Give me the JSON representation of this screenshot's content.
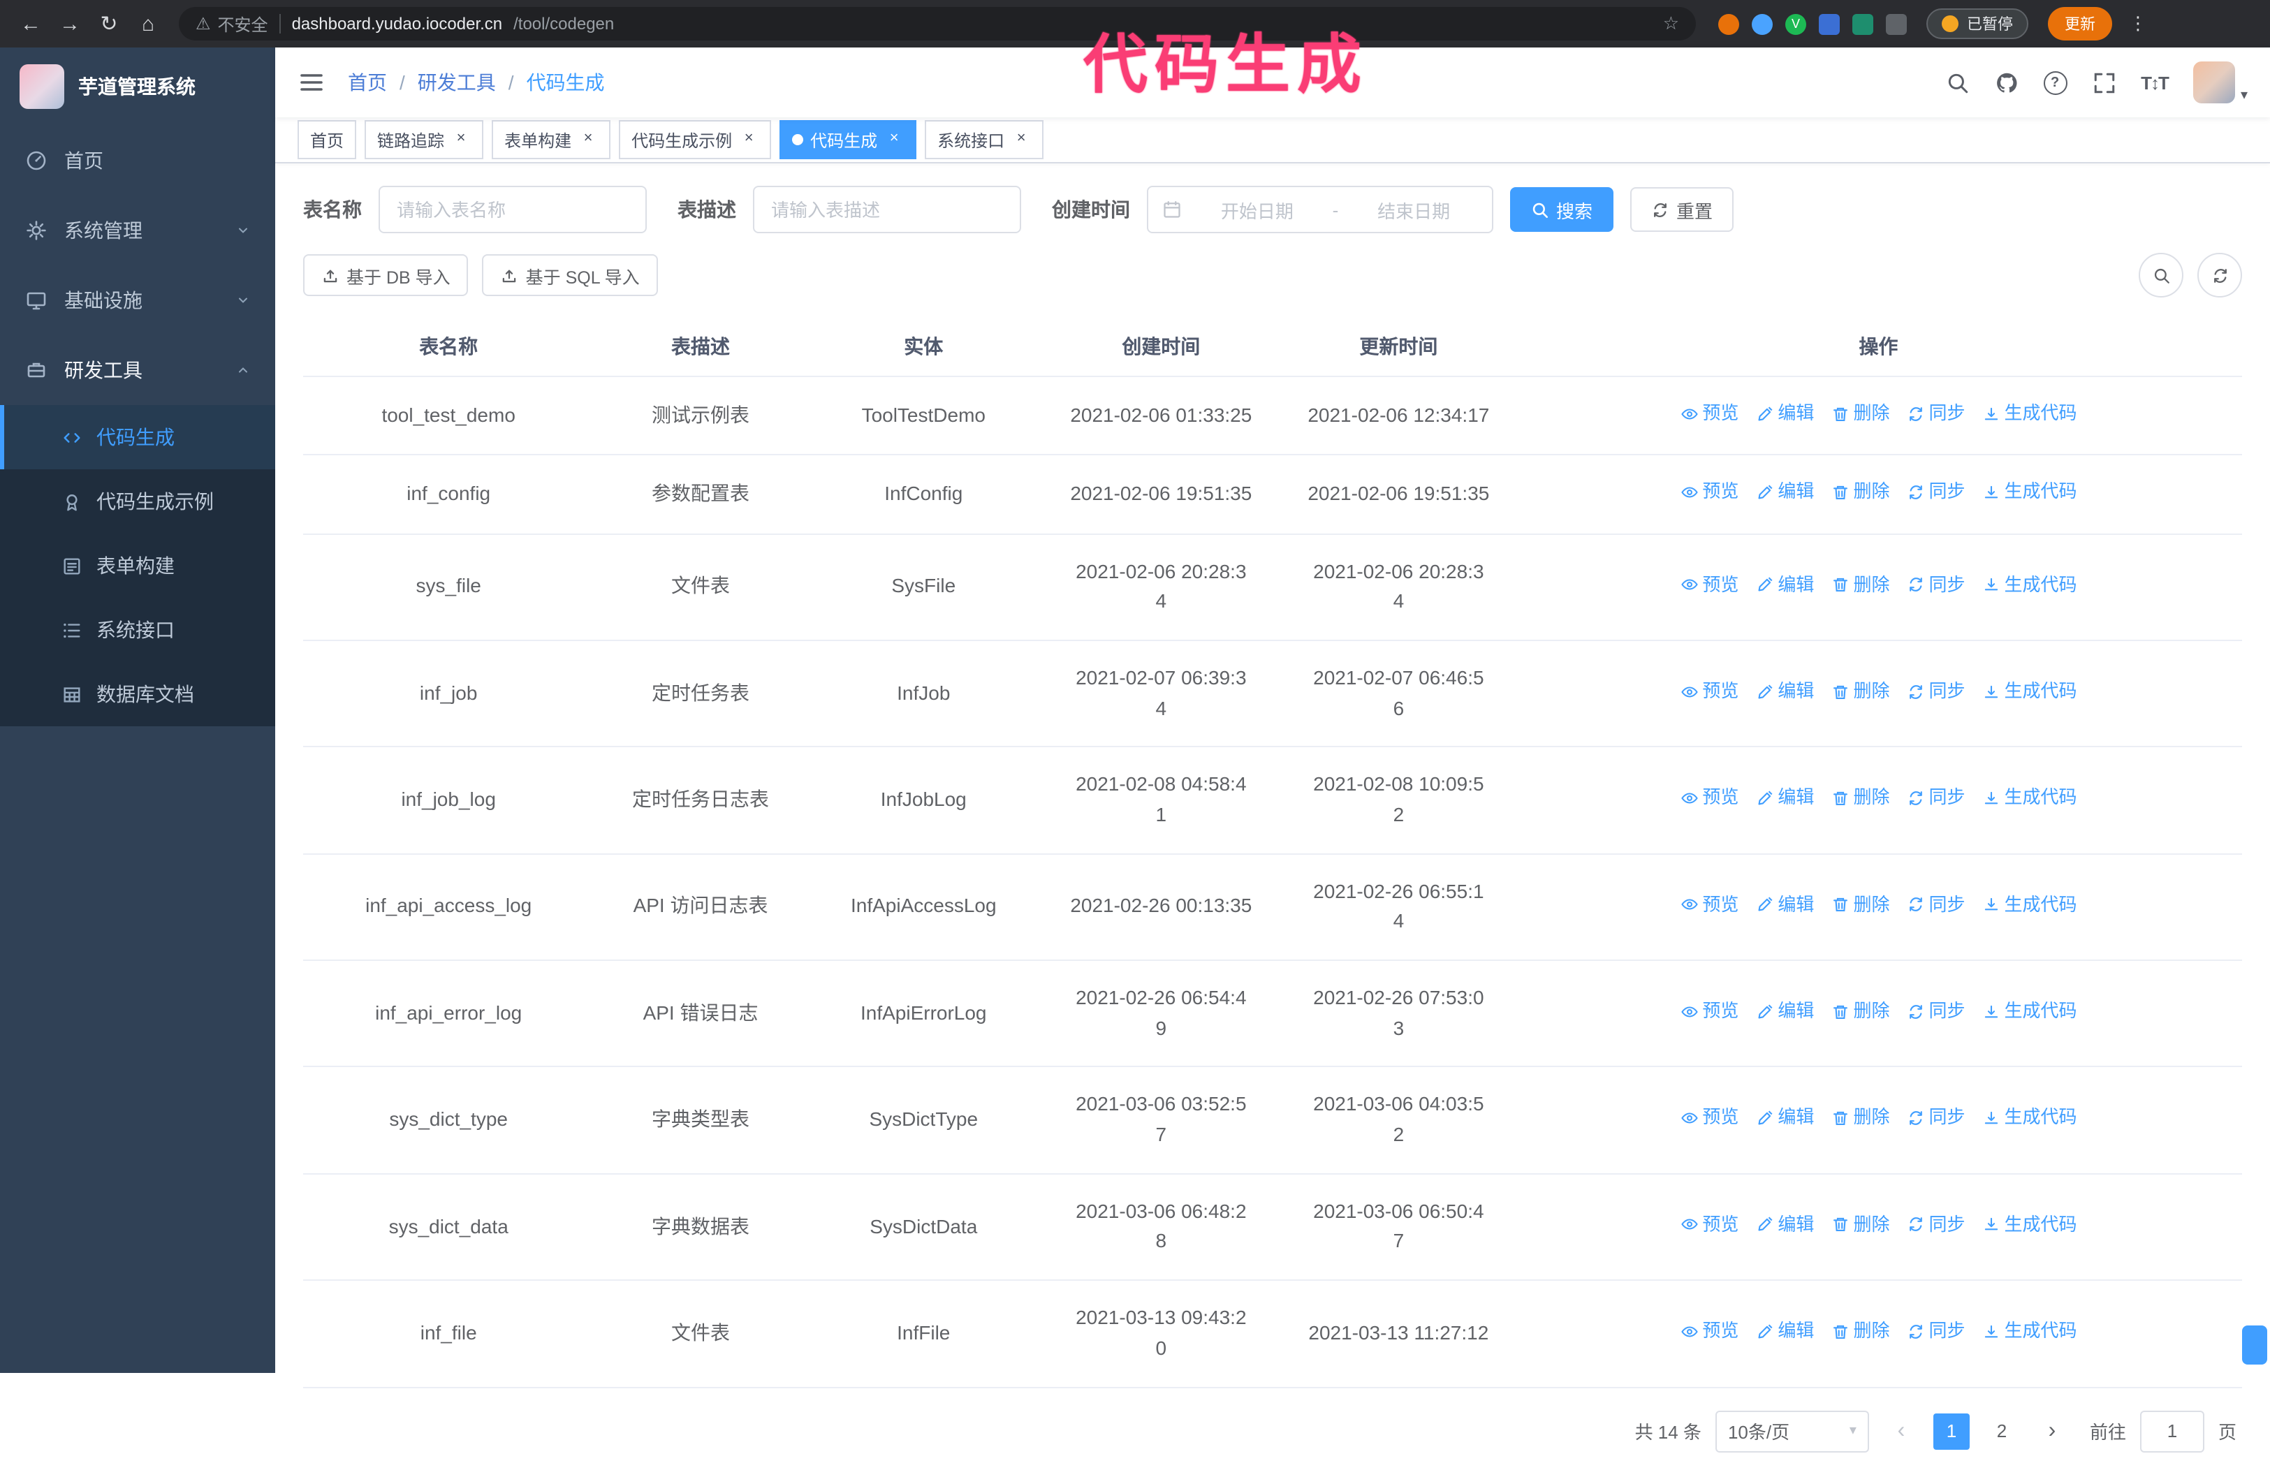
{
  "colors": {
    "accent": "#409eff",
    "annotation": "#fa3d75",
    "sidebar_bg": "#304156"
  },
  "annotation": {
    "text": "代码生成"
  },
  "browser": {
    "security_warning": "不安全",
    "url_host": "dashboard.yudao.iocoder.cn",
    "url_path": "/tool/codegen",
    "paused_badge": "已暂停",
    "update_button": "更新"
  },
  "sidebar": {
    "logo_title": "芋道管理系统",
    "items": [
      {
        "label": "首页",
        "icon": "dashboard-icon"
      },
      {
        "label": "系统管理",
        "icon": "gear-icon"
      },
      {
        "label": "基础设施",
        "icon": "monitor-icon"
      },
      {
        "label": "研发工具",
        "icon": "toolbox-icon"
      }
    ],
    "subitems": [
      {
        "label": "代码生成",
        "icon": "code-icon",
        "active": true
      },
      {
        "label": "代码生成示例",
        "icon": "badge-icon",
        "active": false
      },
      {
        "label": "表单构建",
        "icon": "form-icon",
        "active": false
      },
      {
        "label": "系统接口",
        "icon": "api-list-icon",
        "active": false
      },
      {
        "label": "数据库文档",
        "icon": "db-table-icon",
        "active": false
      }
    ]
  },
  "header": {
    "breadcrumb": [
      "首页",
      "研发工具",
      "代码生成"
    ]
  },
  "tabs": [
    {
      "label": "首页",
      "closable": false,
      "active": false
    },
    {
      "label": "链路追踪",
      "closable": true,
      "active": false
    },
    {
      "label": "表单构建",
      "closable": true,
      "active": false
    },
    {
      "label": "代码生成示例",
      "closable": true,
      "active": false
    },
    {
      "label": "代码生成",
      "closable": true,
      "active": true
    },
    {
      "label": "系统接口",
      "closable": true,
      "active": false
    }
  ],
  "filters": {
    "table_name_label": "表名称",
    "table_name_placeholder": "请输入表名称",
    "table_desc_label": "表描述",
    "table_desc_placeholder": "请输入表描述",
    "create_time_label": "创建时间",
    "date_start_placeholder": "开始日期",
    "date_separator": "-",
    "date_end_placeholder": "结束日期",
    "search_button": "搜索",
    "reset_button": "重置"
  },
  "toolbar": {
    "import_db_button": "基于 DB 导入",
    "import_sql_button": "基于 SQL 导入"
  },
  "table": {
    "columns": [
      "表名称",
      "表描述",
      "实体",
      "创建时间",
      "更新时间",
      "操作"
    ],
    "actions": [
      {
        "key": "preview",
        "label": "预览",
        "icon": "eye-icon"
      },
      {
        "key": "edit",
        "label": "编辑",
        "icon": "pen-icon"
      },
      {
        "key": "delete",
        "label": "删除",
        "icon": "trash-icon"
      },
      {
        "key": "sync",
        "label": "同步",
        "icon": "sync-icon"
      },
      {
        "key": "generate",
        "label": "生成代码",
        "icon": "download-icon"
      }
    ],
    "rows": [
      {
        "name": "tool_test_demo",
        "desc": "测试示例表",
        "entity": "ToolTestDemo",
        "created": "2021-02-06 01:33:25",
        "updated": "2021-02-06 12:34:17"
      },
      {
        "name": "inf_config",
        "desc": "参数配置表",
        "entity": "InfConfig",
        "created": "2021-02-06 19:51:35",
        "updated": "2021-02-06 19:51:35"
      },
      {
        "name": "sys_file",
        "desc": "文件表",
        "entity": "SysFile",
        "created": "2021-02-06 20:28:3\n4",
        "updated": "2021-02-06 20:28:3\n4"
      },
      {
        "name": "inf_job",
        "desc": "定时任务表",
        "entity": "InfJob",
        "created": "2021-02-07 06:39:3\n4",
        "updated": "2021-02-07 06:46:5\n6"
      },
      {
        "name": "inf_job_log",
        "desc": "定时任务日志表",
        "entity": "InfJobLog",
        "created": "2021-02-08 04:58:4\n1",
        "updated": "2021-02-08 10:09:5\n2"
      },
      {
        "name": "inf_api_access_log",
        "desc": "API 访问日志表",
        "entity": "InfApiAccessLog",
        "created": "2021-02-26 00:13:35",
        "updated": "2021-02-26 06:55:1\n4"
      },
      {
        "name": "inf_api_error_log",
        "desc": "API 错误日志",
        "entity": "InfApiErrorLog",
        "created": "2021-02-26 06:54:4\n9",
        "updated": "2021-02-26 07:53:0\n3"
      },
      {
        "name": "sys_dict_type",
        "desc": "字典类型表",
        "entity": "SysDictType",
        "created": "2021-03-06 03:52:5\n7",
        "updated": "2021-03-06 04:03:5\n2"
      },
      {
        "name": "sys_dict_data",
        "desc": "字典数据表",
        "entity": "SysDictData",
        "created": "2021-03-06 06:48:2\n8",
        "updated": "2021-03-06 06:50:4\n7"
      },
      {
        "name": "inf_file",
        "desc": "文件表",
        "entity": "InfFile",
        "created": "2021-03-13 09:43:2\n0",
        "updated": "2021-03-13 11:27:12"
      }
    ]
  },
  "pagination": {
    "total": "共 14 条",
    "page_size": "10条/页",
    "pages": [
      "1",
      "2"
    ],
    "active_page": "1",
    "goto_label": "前往",
    "goto_value": "1",
    "goto_suffix": "页"
  }
}
